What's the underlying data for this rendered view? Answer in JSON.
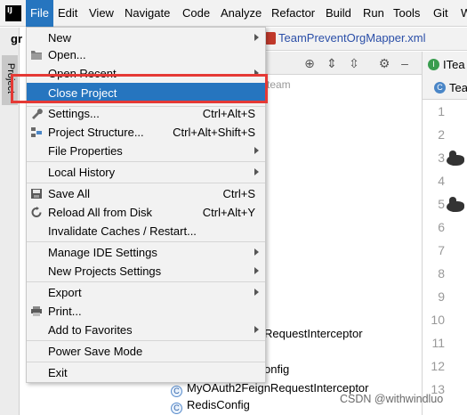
{
  "menubar": {
    "logo": "IJ",
    "items": [
      {
        "label": "File",
        "active": true
      },
      {
        "label": "Edit"
      },
      {
        "label": "View"
      },
      {
        "label": "Navigate"
      },
      {
        "label": "Code"
      },
      {
        "label": "Analyze"
      },
      {
        "label": "Refactor"
      },
      {
        "label": "Build"
      },
      {
        "label": "Run"
      },
      {
        "label": "Tools"
      },
      {
        "label": "Git"
      },
      {
        "label": "W"
      }
    ]
  },
  "sidebar": {
    "project_tab": "Project"
  },
  "breadcrumb_fragment": "gr",
  "editor": {
    "file_tab": "TeamPreventOrgMapper.xml",
    "tool_tree_fragment": "team",
    "right_tabs": [
      "ITea",
      "Tea"
    ],
    "line_numbers": [
      "1",
      "2",
      "3",
      "4",
      "5",
      "6",
      "7",
      "8",
      "9",
      "10",
      "11",
      "12",
      "13"
    ]
  },
  "tree_items": {
    "partial_1": "RequestInterceptor",
    "partial_2": "onfig",
    "item_1": "MyOAuth2FeignRequestInterceptor",
    "item_2": "RedisConfig"
  },
  "file_menu": {
    "items": [
      {
        "label": "New",
        "submenu": true
      },
      {
        "label": "Open...",
        "icon": "folder-icon"
      },
      {
        "label": "Open Recent",
        "submenu": true
      },
      {
        "label": "Close Project",
        "selected": true
      },
      {
        "label": "Settings...",
        "shortcut": "Ctrl+Alt+S",
        "icon": "wrench-icon"
      },
      {
        "label": "Project Structure...",
        "shortcut": "Ctrl+Alt+Shift+S",
        "icon": "project-structure-icon"
      },
      {
        "label": "File Properties",
        "submenu": true
      },
      {
        "label": "Local History",
        "submenu": true
      },
      {
        "label": "Save All",
        "shortcut": "Ctrl+S",
        "icon": "save-icon"
      },
      {
        "label": "Reload All from Disk",
        "shortcut": "Ctrl+Alt+Y",
        "icon": "reload-icon"
      },
      {
        "label": "Invalidate Caches / Restart..."
      },
      {
        "label": "Manage IDE Settings",
        "submenu": true
      },
      {
        "label": "New Projects Settings",
        "submenu": true
      },
      {
        "label": "Export",
        "submenu": true
      },
      {
        "label": "Print...",
        "icon": "print-icon"
      },
      {
        "label": "Add to Favorites",
        "submenu": true
      },
      {
        "label": "Power Save Mode"
      },
      {
        "label": "Exit"
      }
    ]
  },
  "watermark": "CSDN @withwindluo",
  "colors": {
    "selection": "#2675bf",
    "highlight_box": "#e53935",
    "menu_bg": "#f2f2f2"
  }
}
